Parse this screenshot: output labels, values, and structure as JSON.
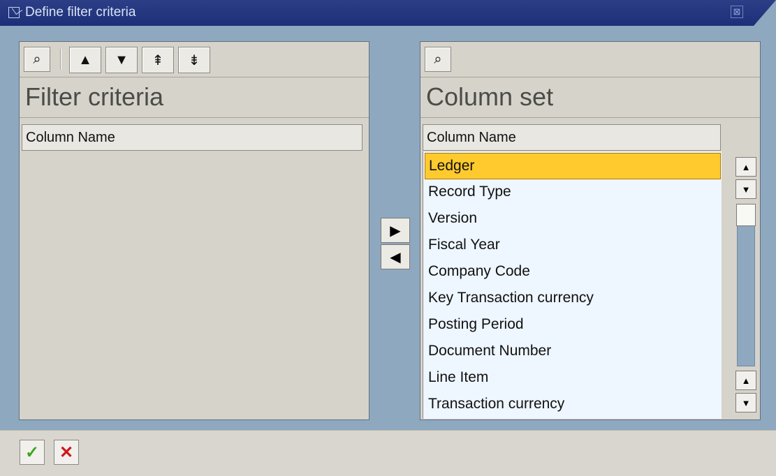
{
  "window": {
    "title": "Define filter criteria",
    "close_icon": "⊠"
  },
  "left_panel": {
    "title": "Filter criteria",
    "column_header": "Column Name",
    "toolbar": {
      "find_icon": "⌕",
      "up_icon": "▲",
      "down_icon": "▼",
      "top_icon": "⇞",
      "bottom_icon": "⇟"
    }
  },
  "right_panel": {
    "title": "Column set",
    "column_header": "Column Name",
    "find_icon": "⌕",
    "items": [
      {
        "label": "Ledger"
      },
      {
        "label": "Record Type"
      },
      {
        "label": "Version"
      },
      {
        "label": "Fiscal Year"
      },
      {
        "label": "Company Code"
      },
      {
        "label": "Key Transaction currency"
      },
      {
        "label": "Posting Period"
      },
      {
        "label": "Document Number"
      },
      {
        "label": "Line Item"
      },
      {
        "label": "Transaction currency"
      }
    ],
    "scroll": {
      "up_icon": "▲",
      "down_icon": "▼",
      "page_up_icon": "▲",
      "page_down_icon": "▼"
    }
  },
  "move_buttons": {
    "right_icon": "▶",
    "left_icon": "◀"
  },
  "actions": {
    "ok_icon": "✓",
    "cancel_icon": "✕"
  }
}
